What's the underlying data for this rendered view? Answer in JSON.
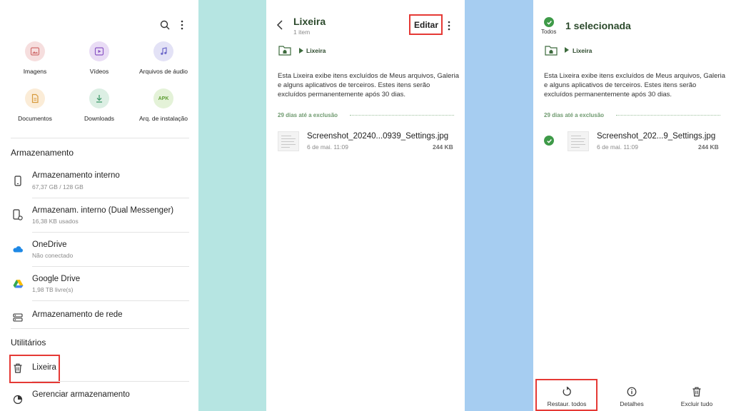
{
  "colors": {
    "strip_left": "#b6e5e2",
    "strip_right": "#a6cdf1",
    "accent_green": "#3e9a48",
    "title_green": "#2c4a2c",
    "highlight_red": "#e53935"
  },
  "panel1": {
    "icons": {
      "search": "search-icon",
      "more": "more-vert-icon"
    },
    "categories": [
      {
        "label": "Imagens",
        "icon": "image-icon",
        "color": "#e8b5b5"
      },
      {
        "label": "Vídeos",
        "icon": "video-icon",
        "color": "#c7a9e4"
      },
      {
        "label": "Arquivos de áudio",
        "icon": "music-note-icon",
        "color": "#b9b7e8"
      },
      {
        "label": "Documentos",
        "icon": "document-icon",
        "color": "#f1d2a6"
      },
      {
        "label": "Downloads",
        "icon": "download-icon",
        "color": "#b8dcc7"
      },
      {
        "label": "Arq. de instalação",
        "icon": "apk-icon",
        "color": "#c9e3b3",
        "badge": "APK"
      }
    ],
    "storage_header": "Armazenamento",
    "storage": [
      {
        "title": "Armazenamento interno",
        "subtitle": "67,37 GB / 128 GB",
        "icon": "phone-icon"
      },
      {
        "title": "Armazenam. interno (Dual Messenger)",
        "subtitle": "16,38 KB usados",
        "icon": "dual-phone-icon"
      },
      {
        "title": "OneDrive",
        "subtitle": "Não conectado",
        "icon": "onedrive-icon"
      },
      {
        "title": "Google Drive",
        "subtitle": "1,98 TB livre(s)",
        "icon": "google-drive-icon"
      },
      {
        "title": "Armazenamento de rede",
        "subtitle": "",
        "icon": "network-storage-icon"
      }
    ],
    "utilities_header": "Utilitários",
    "utilities": [
      {
        "title": "Lixeira",
        "icon": "trash-icon"
      },
      {
        "title": "Gerenciar armazenamento",
        "icon": "storage-manage-icon"
      }
    ]
  },
  "panel2": {
    "title": "Lixeira",
    "subtitle": "1 item",
    "edit_label": "Editar",
    "crumb": "Lixeira",
    "description": "Esta Lixeira exibe itens excluídos de Meus arquivos, Galeria e alguns aplicativos de terceiros. Estes itens serão excluídos permanentemente após 30 dias.",
    "group_label": "29 dias até a exclusão",
    "file": {
      "name": "Screenshot_20240...0939_Settings.jpg",
      "date": "6 de mai. 11:09",
      "size": "244 KB"
    }
  },
  "panel3": {
    "all_label": "Todos",
    "title": "1 selecionada",
    "crumb": "Lixeira",
    "description": "Esta Lixeira exibe itens excluídos de Meus arquivos, Galeria e alguns aplicativos de terceiros. Estes itens serão excluídos permanentemente após 30 dias.",
    "group_label": "29 dias até a exclusão",
    "file": {
      "name": "Screenshot_202...9_Settings.jpg",
      "date": "6 de mai. 11:09",
      "size": "244 KB"
    },
    "actions": [
      {
        "label": "Restaur. todos",
        "icon": "restore-icon"
      },
      {
        "label": "Detalhes",
        "icon": "info-icon"
      },
      {
        "label": "Excluir tudo",
        "icon": "trash-icon"
      }
    ]
  }
}
